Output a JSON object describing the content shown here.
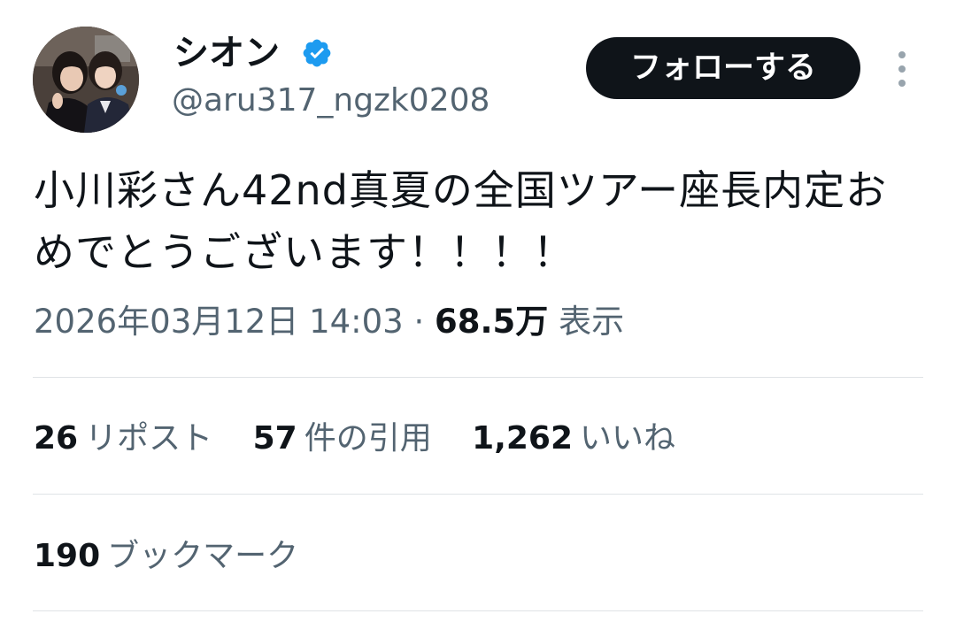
{
  "author": {
    "display_name": "シオン",
    "handle": "@aru317_ngzk0208",
    "verified": true
  },
  "header": {
    "follow_label": "フォローする"
  },
  "tweet": {
    "text": "小川彩さん42nd真夏の全国ツアー座長内定おめでとうございます！！！！",
    "timestamp": "2026年03月12日 14:03",
    "separator": "·",
    "views_count": "68.5万",
    "views_label": "表示"
  },
  "stats": {
    "reposts": {
      "count": "26",
      "label": "リポスト"
    },
    "quotes": {
      "count": "57",
      "label": "件の引用"
    },
    "likes": {
      "count": "1,262",
      "label": "いいね"
    },
    "bookmarks": {
      "count": "190",
      "label": "ブックマーク"
    }
  },
  "colors": {
    "primary_text": "#0f1419",
    "secondary_text": "#536471",
    "verified_badge": "#1d9bf0",
    "divider": "#dfe3e6",
    "follow_button_bg": "#0f1419"
  },
  "icons": {
    "verified": "verified-badge-icon",
    "more": "more-vertical-icon"
  }
}
